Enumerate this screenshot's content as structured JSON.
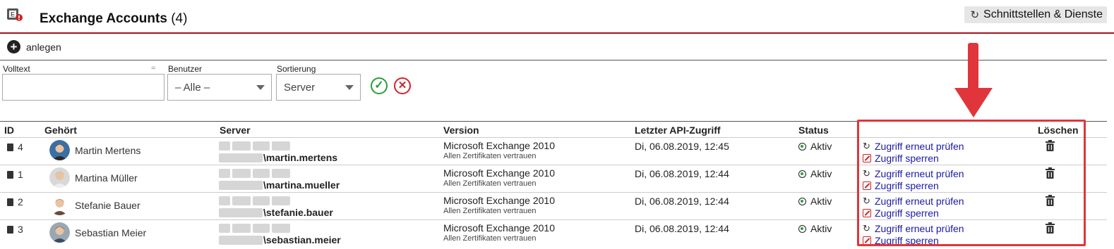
{
  "header": {
    "title": "Exchange Accounts",
    "count": "(4)",
    "app_icon": "exchange-mail-icon",
    "services_button": "Schnittstellen & Dienste",
    "services_icon": "refresh-icon"
  },
  "toolbar": {
    "add_label": "anlegen",
    "add_icon": "plus-circle-icon"
  },
  "filters": {
    "fulltext_label": "Volltext",
    "fulltext_value": "",
    "fuzzy_symbol": "≈",
    "user_label": "Benutzer",
    "user_value": "– Alle –",
    "sort_label": "Sortierung",
    "sort_value": "Server",
    "apply_icon": "check-circle-icon",
    "reset_icon": "x-circle-icon"
  },
  "table": {
    "columns": {
      "id": "ID",
      "owner": "Gehört",
      "server": "Server",
      "version": "Version",
      "last_access": "Letzter API-Zugriff",
      "status": "Status",
      "actions": "",
      "delete": "Löschen"
    },
    "rows": [
      {
        "id": "4",
        "owner": "Martin Mertens",
        "server_user": "\\martin.mertens",
        "version": "Microsoft Exchange 2010",
        "version_note": "Allen Zertifikaten vertrauen",
        "last_access": "Di, 06.08.2019, 12:45",
        "status": "Aktiv",
        "action_check": "Zugriff erneut prüfen",
        "action_lock": "Zugriff sperren"
      },
      {
        "id": "1",
        "owner": "Martina Müller",
        "server_user": "\\martina.mueller",
        "version": "Microsoft Exchange 2010",
        "version_note": "Allen Zertifikaten vertrauen",
        "last_access": "Di, 06.08.2019, 12:44",
        "status": "Aktiv",
        "action_check": "Zugriff erneut prüfen",
        "action_lock": "Zugriff sperren"
      },
      {
        "id": "2",
        "owner": "Stefanie Bauer",
        "server_user": "\\stefanie.bauer",
        "version": "Microsoft Exchange 2010",
        "version_note": "Allen Zertifikaten vertrauen",
        "last_access": "Di, 06.08.2019, 12:44",
        "status": "Aktiv",
        "action_check": "Zugriff erneut prüfen",
        "action_lock": "Zugriff sperren"
      },
      {
        "id": "3",
        "owner": "Sebastian Meier",
        "server_user": "\\sebastian.meier",
        "version": "Microsoft Exchange 2010",
        "version_note": "Allen Zertifikaten vertrauen",
        "last_access": "Di, 06.08.2019, 12:44",
        "status": "Aktiv",
        "action_check": "Zugriff erneut prüfen",
        "action_lock": "Zugriff sperren"
      }
    ]
  },
  "colors": {
    "accent_red": "#a3151b",
    "highlight_red": "#e0353b",
    "link_blue": "#1a1aa6",
    "ok_green": "#2a9d3a"
  }
}
